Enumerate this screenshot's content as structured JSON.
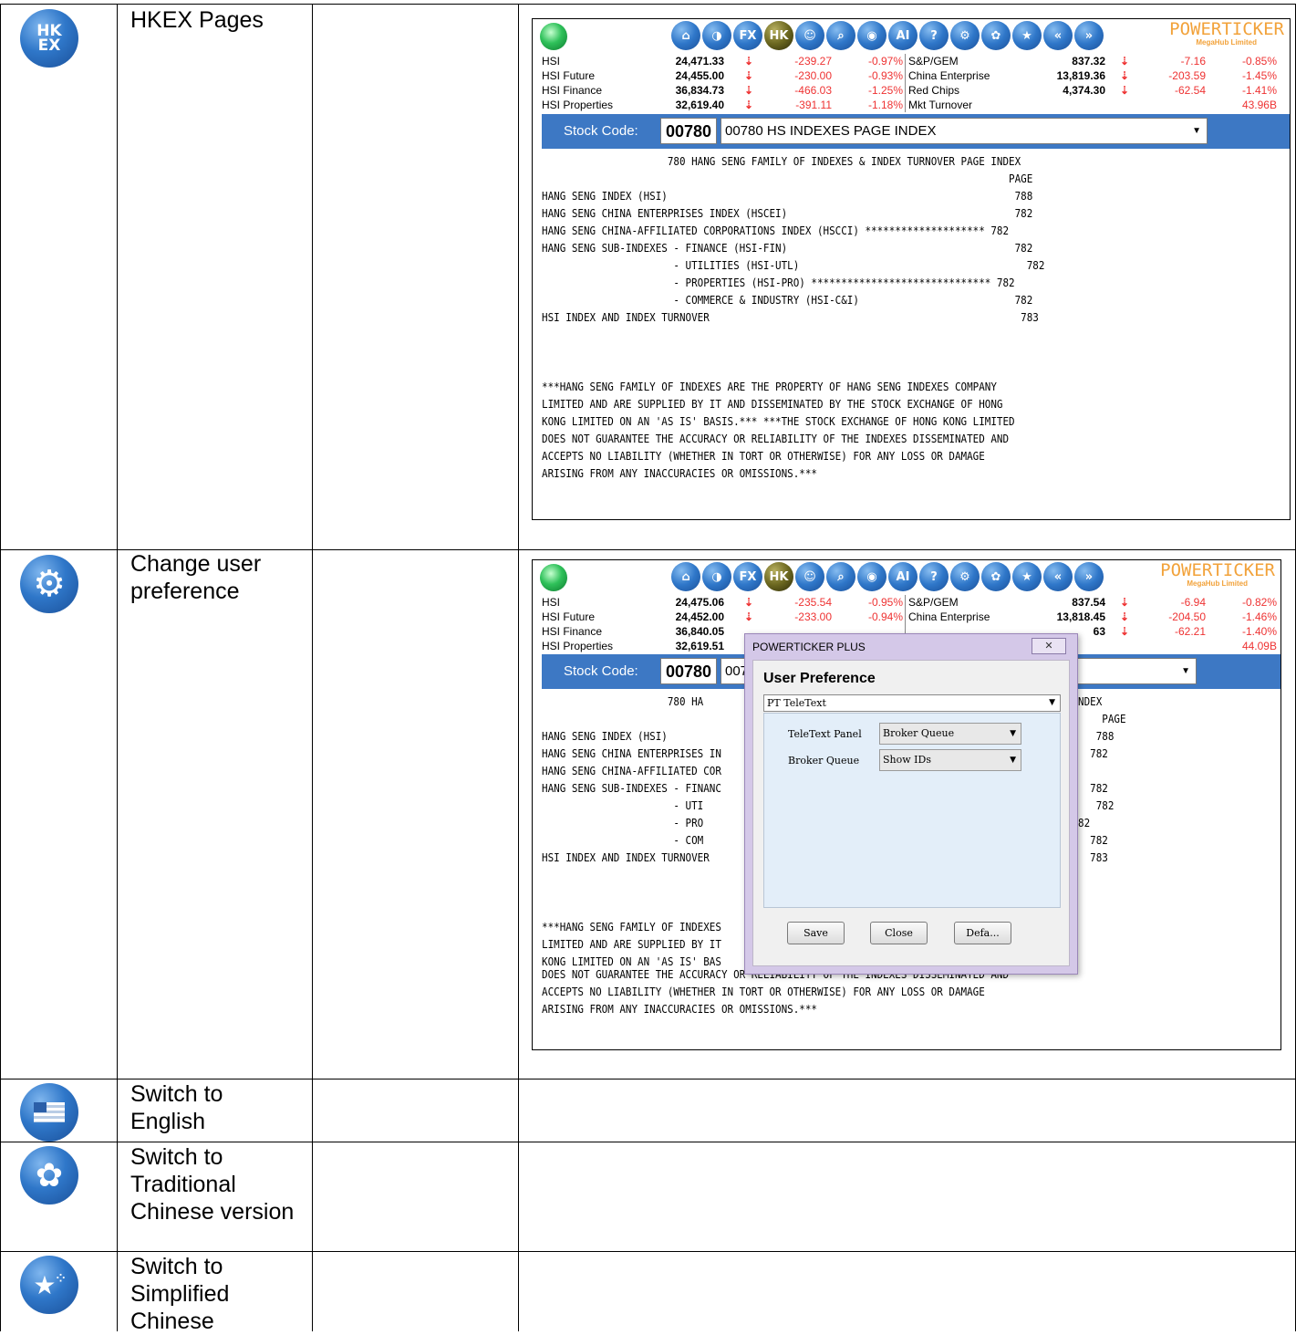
{
  "rows": [
    {
      "icon": "HK EX",
      "label": "HKEX Pages"
    },
    {
      "icon": "gear",
      "label": "Change user preference"
    },
    {
      "icon": "flag",
      "label": "Switch to English"
    },
    {
      "icon": "bauhinia",
      "label": "Switch to Traditional Chinese version"
    },
    {
      "icon": "stars",
      "label": "Switch to Simplified Chinese"
    }
  ],
  "brand": {
    "name": "POWERTICKER",
    "sub": "MegaHub Limited"
  },
  "toolbar_icons": [
    "home-icon",
    "globe-icon",
    "fx-icon",
    "hkex-icon",
    "user-icon",
    "search-icon",
    "pin-icon",
    "ai-icon",
    "help-icon",
    "settings-icon",
    "bauhinia-icon",
    "china-stars-icon",
    "back-icon",
    "forward-icon"
  ],
  "toolbar_icon_labels": [
    "⌂",
    "◑",
    "FX",
    "HK",
    "☺",
    "⌕",
    "◉",
    "AI",
    "?",
    "⚙",
    "✿",
    "★",
    "«",
    "»"
  ],
  "shot1": {
    "quotes": [
      {
        "name": "HSI",
        "value": "24,471.33",
        "change": "-239.27",
        "pct": "-0.97%",
        "name2": "S&P/GEM",
        "value2": "837.32",
        "change2": "-7.16",
        "pct2": "-0.85%"
      },
      {
        "name": "HSI Future",
        "value": "24,455.00",
        "change": "-230.00",
        "pct": "-0.93%",
        "name2": "China Enterprise",
        "value2": "13,819.36",
        "change2": "-203.59",
        "pct2": "-1.45%"
      },
      {
        "name": "HSI Finance",
        "value": "36,834.73",
        "change": "-466.03",
        "pct": "-1.25%",
        "name2": "Red Chips",
        "value2": "4,374.30",
        "change2": "-62.54",
        "pct2": "-1.41%"
      },
      {
        "name": "HSI Properties",
        "value": "32,619.40",
        "change": "-391.11",
        "pct": "-1.18%",
        "name2": "Mkt Turnover",
        "value2": "",
        "change2": "",
        "pct2": "43.96B"
      }
    ],
    "stock_label": "Stock Code:",
    "stock_code": "00780",
    "stock_select": "00780 HS INDEXES PAGE INDEX",
    "teletext": "                     780 HANG SENG FAMILY OF INDEXES & INDEX TURNOVER PAGE INDEX\n                                                                              PAGE\nHANG SENG INDEX (HSI)                                                          788\nHANG SENG CHINA ENTERPRISES INDEX (HSCEI)                                      782\nHANG SENG CHINA-AFFILIATED CORPORATIONS INDEX (HSCCI) ******************** 782\nHANG SENG SUB-INDEXES - FINANCE (HSI-FIN)                                      782\n                      - UTILITIES (HSI-UTL)                                      782\n                      - PROPERTIES (HSI-PRO) ****************************** 782\n                      - COMMERCE & INDUSTRY (HSI-C&I)                          782\nHSI INDEX AND INDEX TURNOVER                                                    783\n\n\n\n***HANG SENG FAMILY OF INDEXES ARE THE PROPERTY OF HANG SENG INDEXES COMPANY\nLIMITED AND ARE SUPPLIED BY IT AND DISSEMINATED BY THE STOCK EXCHANGE OF HONG\nKONG LIMITED ON AN 'AS IS' BASIS.*** ***THE STOCK EXCHANGE OF HONG KONG LIMITED\nDOES NOT GUARANTEE THE ACCURACY OR RELIABILITY OF THE INDEXES DISSEMINATED AND\nACCEPTS NO LIABILITY (WHETHER IN TORT OR OTHERWISE) FOR ANY LOSS OR DAMAGE\nARISING FROM ANY INACCURACIES OR OMISSIONS.***"
  },
  "shot2": {
    "quotes": [
      {
        "name": "HSI",
        "value": "24,475.06",
        "change": "-235.54",
        "pct": "-0.95%",
        "name2": "S&P/GEM",
        "value2": "837.54",
        "change2": "-6.94",
        "pct2": "-0.82%"
      },
      {
        "name": "HSI Future",
        "value": "24,452.00",
        "change": "-233.00",
        "pct": "-0.94%",
        "name2": "China Enterprise",
        "value2": "13,818.45",
        "change2": "-204.50",
        "pct2": "-1.46%"
      },
      {
        "name": "HSI Finance",
        "value": "36,840.05",
        "change": "",
        "pct": "",
        "name2": "",
        "value2": "63",
        "change2": "-62.21",
        "pct2": "-1.40%"
      },
      {
        "name": "HSI Properties",
        "value": "32,619.51",
        "change": "",
        "pct": "",
        "name2": "",
        "value2": "",
        "change2": "",
        "pct2": "44.09B"
      }
    ],
    "stock_label": "Stock Code:",
    "stock_code": "00780",
    "stock_select": "007",
    "teletext_left": "                     780 HA\n\nHANG SENG INDEX (HSI)\nHANG SENG CHINA ENTERPRISES IN\nHANG SENG CHINA-AFFILIATED COR\nHANG SENG SUB-INDEXES - FINANC\n                      - UTI\n                      - PRO\n                      - COM\nHSI INDEX AND INDEX TURNOVER\n\n\n\n***HANG SENG FAMILY OF INDEXES\nLIMITED AND ARE SUPPLIED BY IT\nKONG LIMITED ON AN 'AS IS' BAS",
    "teletext_right": "NDEX\n    PAGE\n   788\n  782\n\n  782\n   782\n82\n  782\n  783",
    "teletext_bottom": "DOES NOT GUARANTEE THE ACCURACY OR RELIABILITY OF THE INDEXES DISSEMINATED AND\nACCEPTS NO LIABILITY (WHETHER IN TORT OR OTHERWISE) FOR ANY LOSS OR DAMAGE\nARISING FROM ANY INACCURACIES OR OMISSIONS.***",
    "dialog": {
      "title": "POWERTICKER PLUS",
      "close": "✕",
      "heading": "User Preference",
      "combo": "PT TeleText",
      "fields": [
        {
          "label": "TeleText Panel",
          "value": "Broker Queue"
        },
        {
          "label": "Broker Queue",
          "value": "Show IDs"
        }
      ],
      "buttons": [
        "Save",
        "Close",
        "Defa..."
      ]
    }
  }
}
